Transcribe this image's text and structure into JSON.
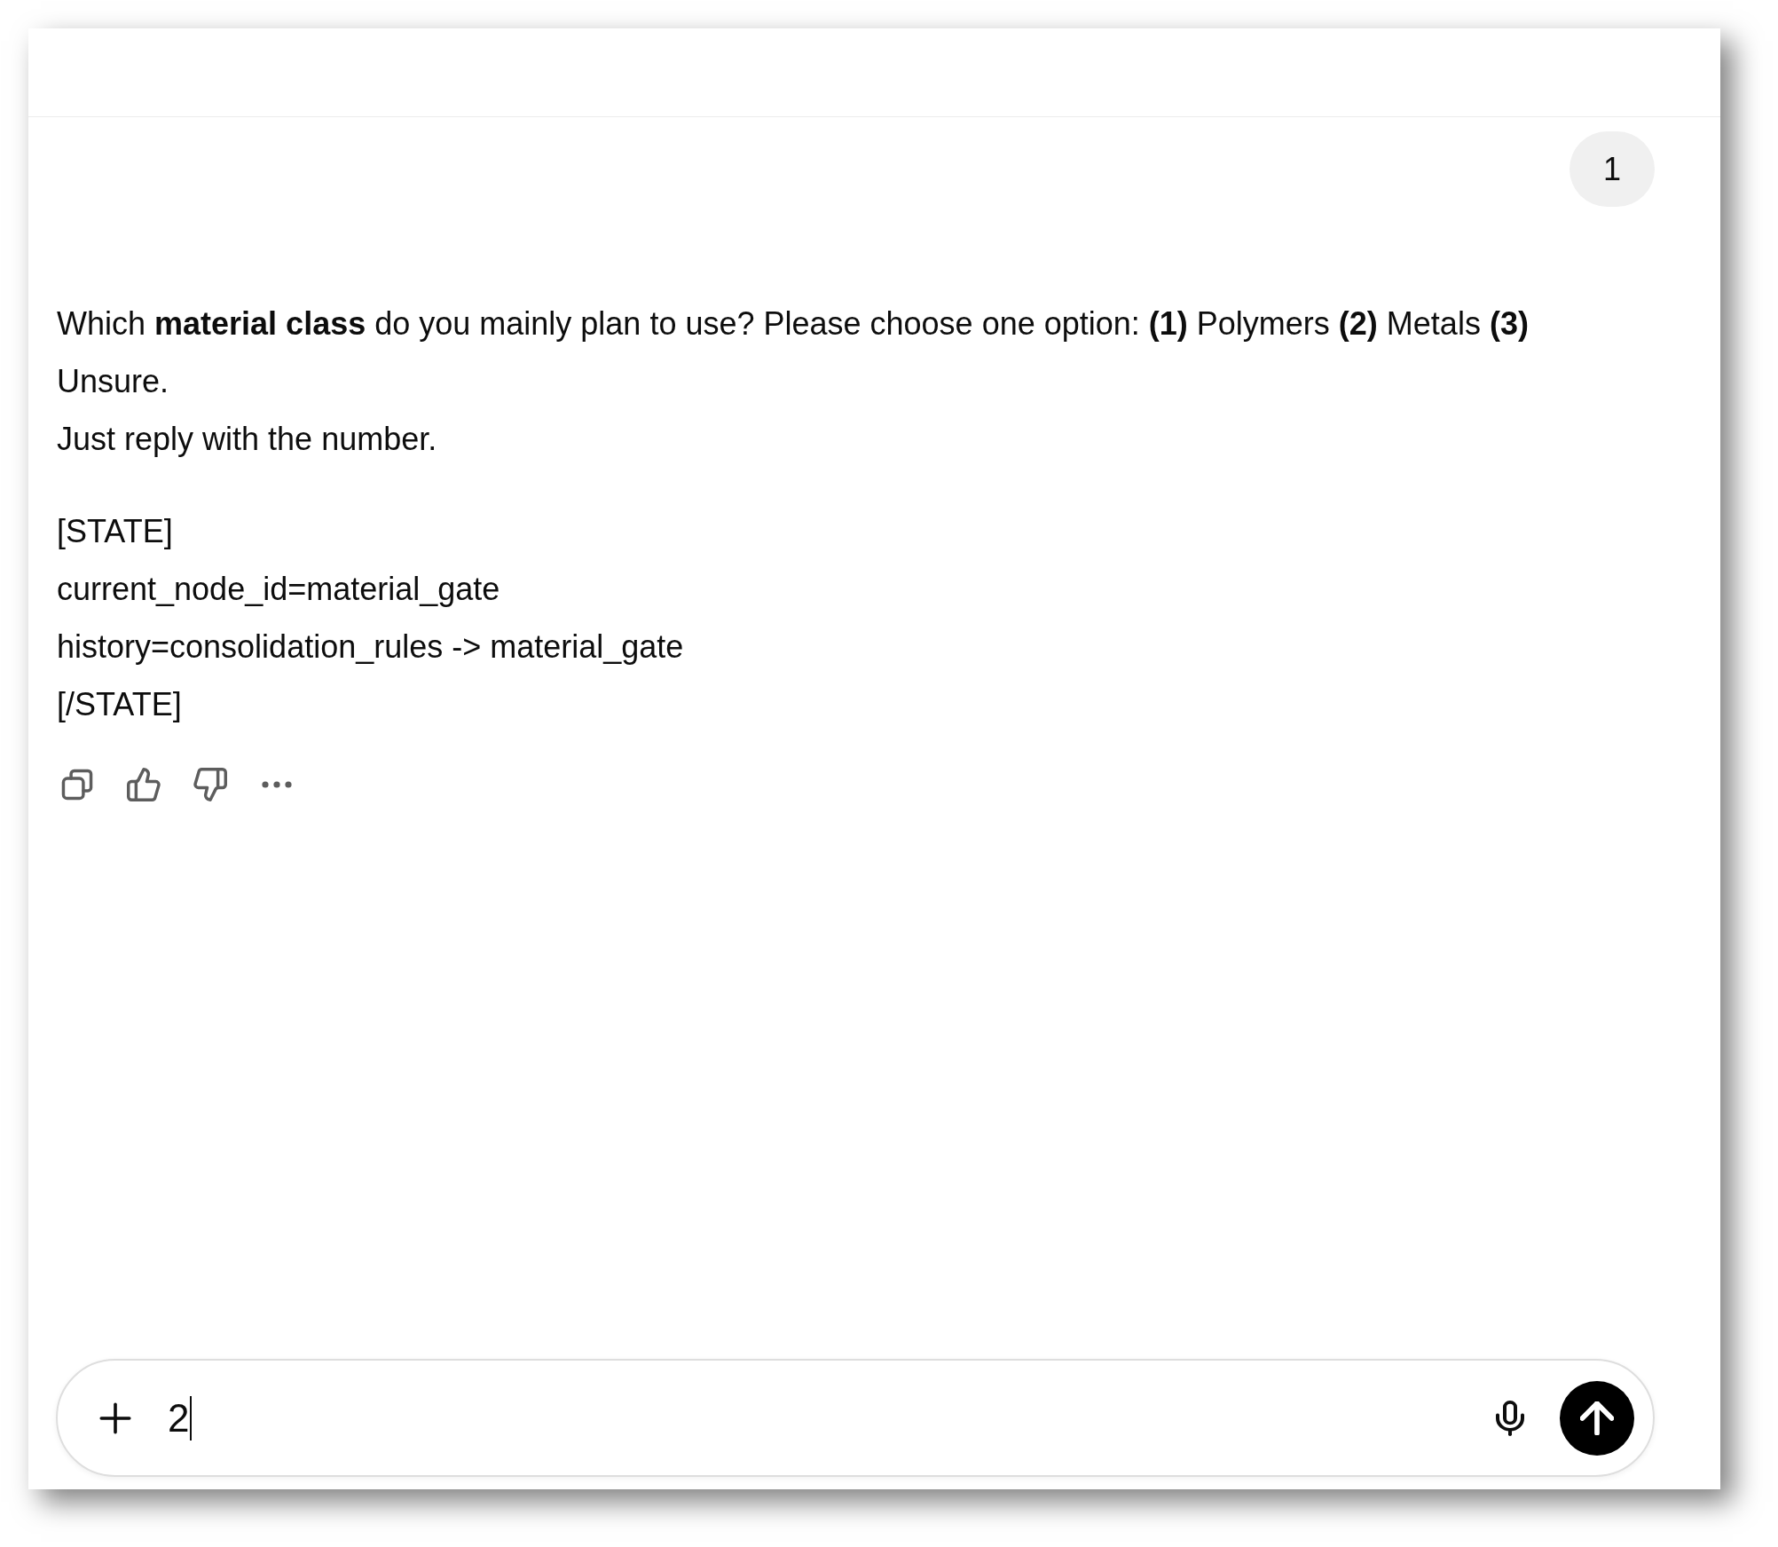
{
  "user_message": {
    "text": "1"
  },
  "assistant_message": {
    "paragraphs": [
      {
        "lines": [
          "Which **material class** do you mainly plan to use? Please choose one option: **(1)** Polymers **(2)** Metals **(3)** Unsure.",
          "Just reply with the number."
        ]
      },
      {
        "lines": [
          "[STATE]",
          "current_node_id=material_gate",
          "history=consolidation_rules -> material_gate",
          "[/STATE]"
        ]
      }
    ],
    "actions": [
      {
        "kind": "copy"
      },
      {
        "kind": "thumbs_up"
      },
      {
        "kind": "thumbs_down"
      },
      {
        "kind": "more"
      }
    ]
  },
  "composer": {
    "value": "2",
    "focused": true
  }
}
